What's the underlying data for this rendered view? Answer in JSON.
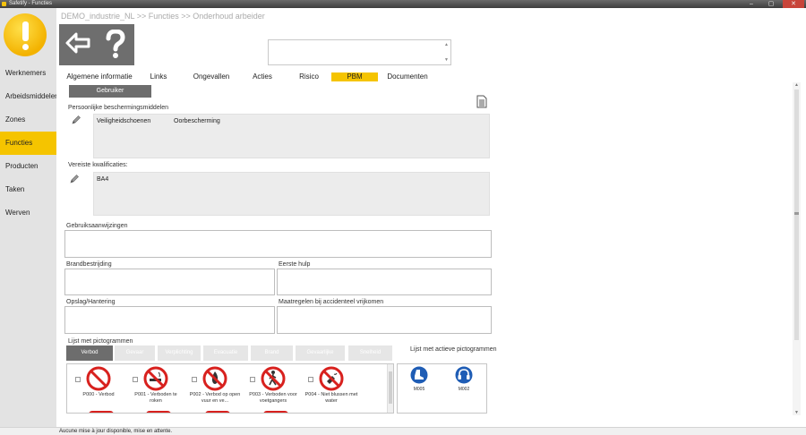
{
  "window": {
    "title": "Safetify - Functies",
    "minimize": "–",
    "maximize": "▢",
    "close": "✕"
  },
  "breadcrumb": "DEMO_industrie_NL >> Functies >> Onderhoud arbeider",
  "sidebar": {
    "items": [
      {
        "label": "Werknemers"
      },
      {
        "label": "Arbeidsmiddelen"
      },
      {
        "label": "Zones"
      },
      {
        "label": "Functies",
        "active": true
      },
      {
        "label": "Producten"
      },
      {
        "label": "Taken"
      },
      {
        "label": "Werven"
      }
    ]
  },
  "search": {
    "value": ""
  },
  "tabs": [
    {
      "label": "Algemene informatie"
    },
    {
      "label": "Links"
    },
    {
      "label": "Ongevallen"
    },
    {
      "label": "Acties"
    },
    {
      "label": "Risico"
    },
    {
      "label": "PBM",
      "active": true
    },
    {
      "label": "Documenten"
    }
  ],
  "gebruiker_button": "Gebruiker",
  "pbm": {
    "label": "Persoonlijke beschermingsmiddelen",
    "items": [
      "Veiligheidschoenen",
      "Oorbescherming"
    ]
  },
  "kwalificaties": {
    "label": "Vereiste kwalificaties:",
    "items": [
      "BA4"
    ]
  },
  "fields": {
    "gebruiksaanwijzingen": "Gebruiksaanwijzingen",
    "brandbestrijding": "Brandbestrijding",
    "eerste_hulp": "Eerste hulp",
    "opslag": "Opslag/Hantering",
    "maatregelen": "Maatregelen bij accidenteel vrijkomen"
  },
  "pictograms": {
    "list_label": "Lijst met pictogrammen",
    "active_label": "Lijst met actieve pictogrammen",
    "tabs": [
      {
        "label": "Verbod",
        "active": true
      },
      {
        "label": "Gevaar"
      },
      {
        "label": "Verplichting"
      },
      {
        "label": "Evacuatie"
      },
      {
        "label": "Brand"
      },
      {
        "label": "Gevaarlijke"
      },
      {
        "label": "Snelheid"
      }
    ],
    "items": [
      {
        "caption": "P000 - Verbod"
      },
      {
        "caption": "P001 - Verboden te roken"
      },
      {
        "caption": "P002 - Verbod op open vuur en ve..."
      },
      {
        "caption": "P003 - Verboden voor voetgangers"
      },
      {
        "caption": "P004 - Niet blussen met water"
      }
    ],
    "active": [
      {
        "caption": "M005"
      },
      {
        "caption": "M002"
      }
    ],
    "colors": {
      "prohibition": "#d8211e",
      "mandatory": "#1f5db5"
    }
  },
  "status": "Aucune mise à jour disponible, mise en attente."
}
